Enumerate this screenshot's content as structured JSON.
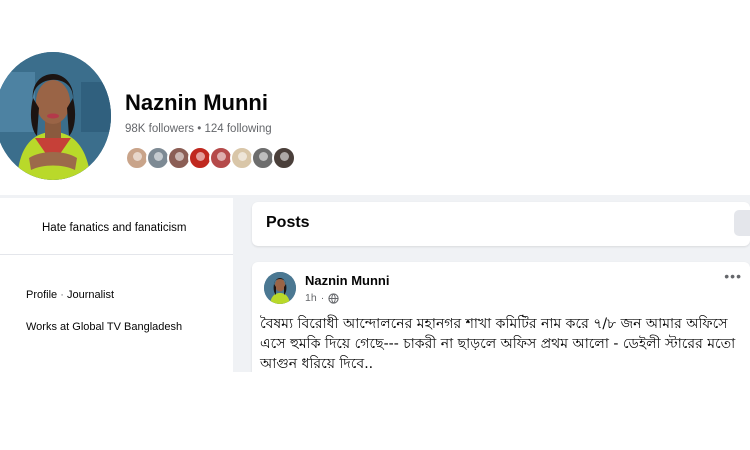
{
  "profile": {
    "name": "Naznin Munni",
    "followers": "98K followers",
    "separator": "•",
    "following": "124 following",
    "friend_avatar_colors": [
      "#c9a48a",
      "#7d8a94",
      "#8b5e55",
      "#c0281f",
      "#b54a4a",
      "#d9c6a8",
      "#6d6d6d",
      "#4a3f3a"
    ]
  },
  "intro": {
    "bio": "Hate fanatics and fanaticism",
    "profile_label": "Profile",
    "profile_separator": " · ",
    "profile_role": "Journalist",
    "work_prefix": "Works at ",
    "work_place": "Global TV Bangladesh"
  },
  "posts_section": {
    "title": "Posts"
  },
  "post": {
    "author": "Naznin Munni",
    "time": "1h",
    "visibility_icon": "globe-icon",
    "more_icon": "more-options-icon",
    "text": "বৈষম্য বিরোধী আন্দোলনের মহানগর শাখা কমিটির নাম করে  ৭/৮ জন  আমার অফিসে এসে হুমকি দিয়ে গেছে---  চাকরী না ছাড়লে অফিস প্রথম আলো - ডেইলী স্টারের মতো আগুন ধরিয়ে দিবে.."
  },
  "colors": {
    "background": "#f0f2f5",
    "card": "#ffffff",
    "text_primary": "#050505",
    "text_secondary": "#65676b"
  }
}
